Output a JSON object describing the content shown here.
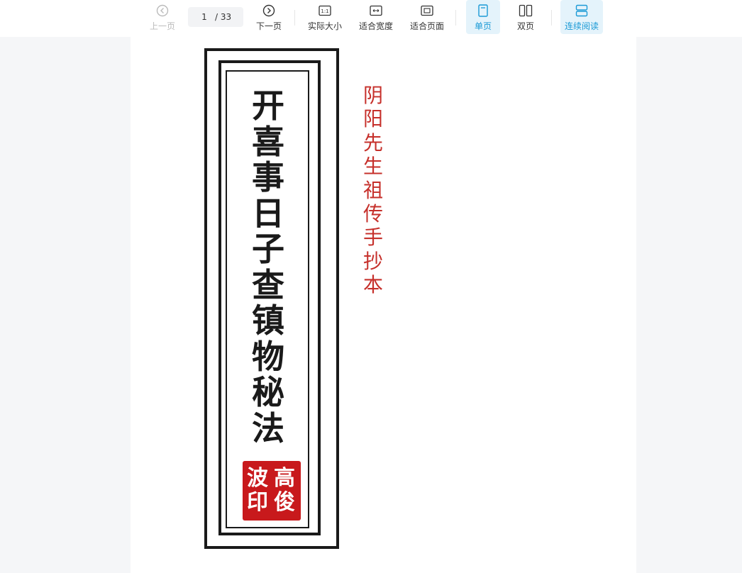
{
  "toolbar": {
    "prev_label": "上一页",
    "page_current": "1",
    "page_total": "/ 33",
    "next_label": "下一页",
    "actual_size_label": "实际大小",
    "actual_size_icon_text": "1:1",
    "fit_width_label": "适合宽度",
    "fit_page_label": "适合页面",
    "single_page_label": "单页",
    "double_page_label": "双页",
    "continuous_label": "连续阅读",
    "active": [
      "single-page",
      "continuous-reading"
    ],
    "icons": [
      "chevron-left-circle-icon",
      "chevron-right-circle-icon",
      "actual-size-icon",
      "fit-width-icon",
      "fit-page-icon",
      "single-page-icon",
      "double-page-icon",
      "continuous-icon"
    ],
    "colors": {
      "accent": "#1a9ad6",
      "active_bg": "#e4f3fb"
    }
  },
  "document": {
    "title": "开喜事日子查镇物秘法",
    "subtitle": "阴阳先生祖传手抄本",
    "seal_right": "高俊",
    "seal_left": "波印",
    "colors": {
      "title": "#1a1a1a",
      "subtitle": "#c6302b",
      "seal": "#c8191c"
    }
  }
}
